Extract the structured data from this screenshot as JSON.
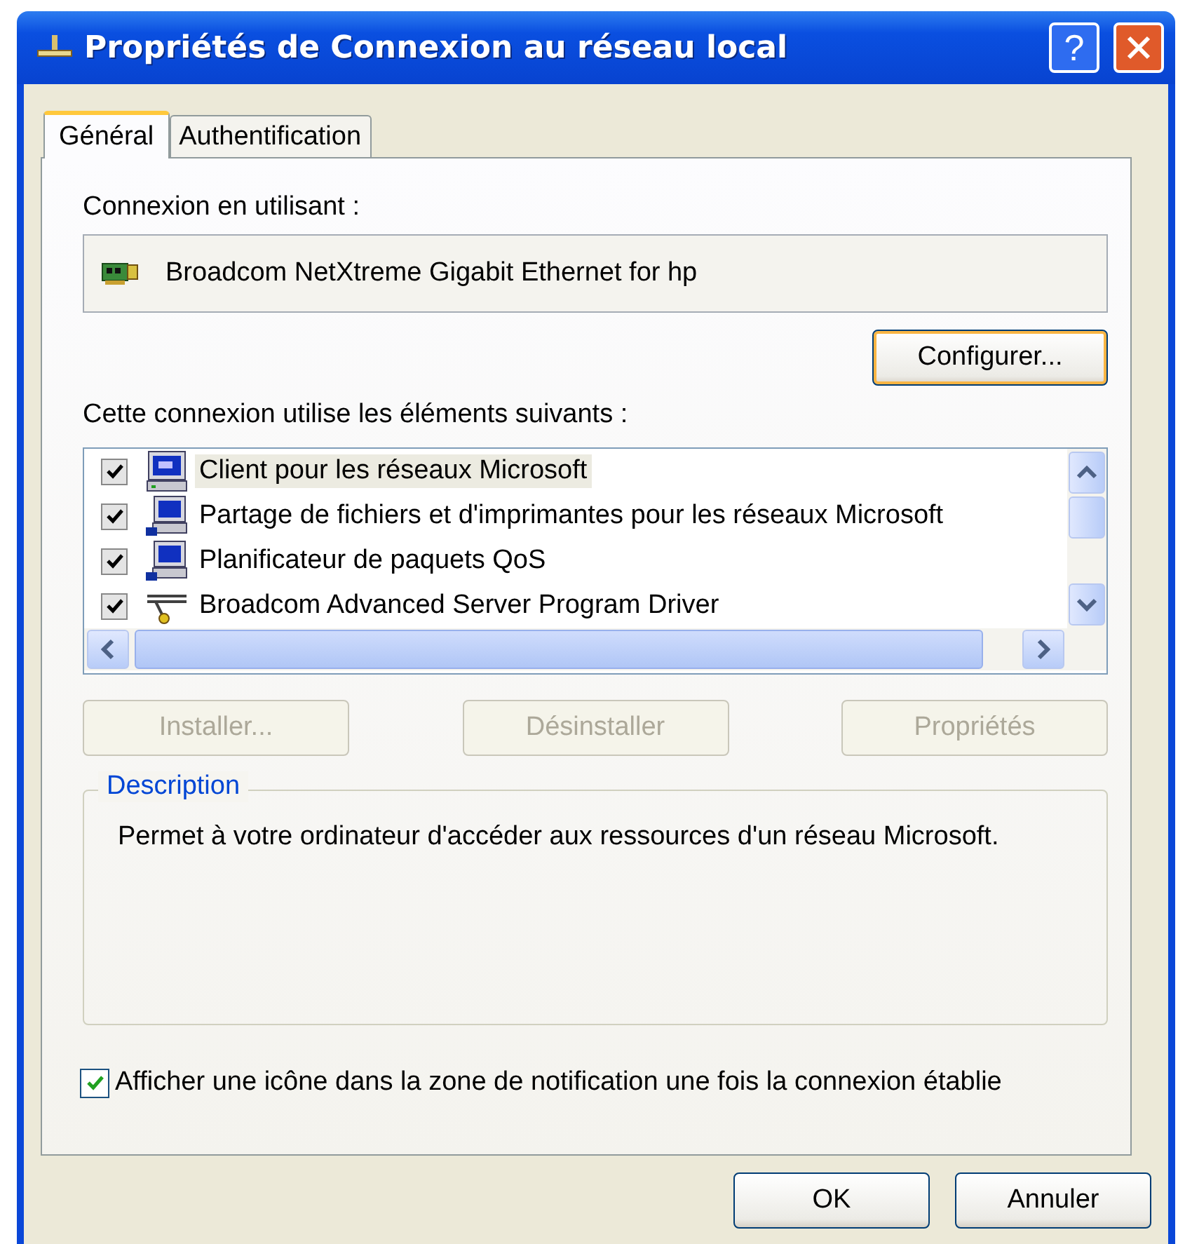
{
  "window": {
    "title": "Propriétés de Connexion au réseau local",
    "help": "?"
  },
  "tabs": [
    {
      "label": "Général",
      "selected": true
    },
    {
      "label": "Authentification",
      "selected": false
    }
  ],
  "connect_using": {
    "label": "Connexion en utilisant :",
    "adapter": "Broadcom NetXtreme Gigabit Ethernet for hp",
    "configure_button": "Configurer..."
  },
  "components": {
    "label": "Cette connexion utilise les éléments suivants :",
    "items": [
      {
        "label": "Client pour les réseaux Microsoft",
        "kind": "client",
        "checked": true,
        "selected": true
      },
      {
        "label": "Partage de fichiers et d'imprimantes pour les réseaux Microsoft",
        "kind": "service",
        "checked": true,
        "selected": false
      },
      {
        "label": "Planificateur de paquets QoS",
        "kind": "service",
        "checked": true,
        "selected": false
      },
      {
        "label": "Broadcom Advanced Server Program Driver",
        "kind": "driver",
        "checked": true,
        "selected": false
      }
    ]
  },
  "item_buttons": [
    {
      "label": "Installer...",
      "disabled": true
    },
    {
      "label": "Désinstaller",
      "disabled": true
    },
    {
      "label": "Propriétés",
      "disabled": true
    }
  ],
  "description": {
    "legend": "Description",
    "text": "Permet à votre ordinateur d'accéder aux ressources d'un réseau Microsoft."
  },
  "notify_checkbox": {
    "label": "Afficher une icône dans la zone de notification une fois la connexion établie",
    "checked": true
  },
  "buttons": [
    "OK",
    "Annuler"
  ]
}
